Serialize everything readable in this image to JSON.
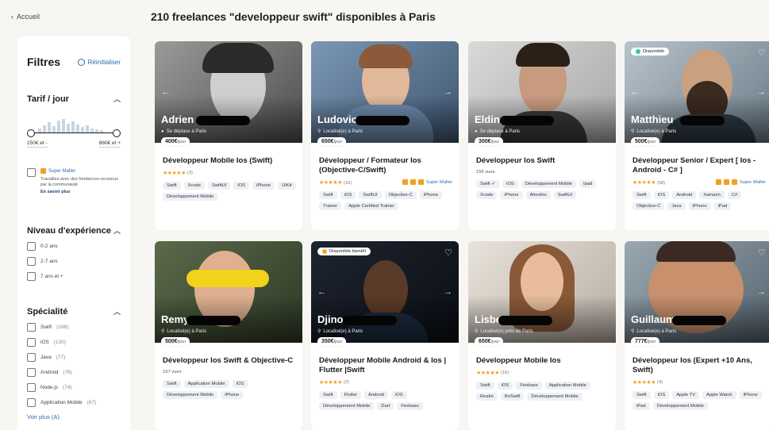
{
  "nav": {
    "back_label": "Accueil"
  },
  "page_title": "210 freelances \"developpeur swift\" disponibles à Paris",
  "filters": {
    "title": "Filtres",
    "reset_label": "Réinitialiser",
    "tarif": {
      "label": "Tarif / jour",
      "min_label": "250€ et -",
      "max_label": "860€ et +"
    },
    "super_malter": {
      "label": "Super Malter",
      "description": "Travaillez avec des freelances reconnus par la communauté",
      "learn_more": "En savoir plus"
    },
    "experience": {
      "label": "Niveau d'expérience",
      "options": [
        "0-2 ans",
        "2-7 ans",
        "7 ans et +"
      ]
    },
    "specialite": {
      "label": "Spécialité",
      "options": [
        {
          "name": "Swift",
          "count": "(196)"
        },
        {
          "name": "iOS",
          "count": "(130)"
        },
        {
          "name": "Java",
          "count": "(77)"
        },
        {
          "name": "Android",
          "count": "(76)"
        },
        {
          "name": "Node.js",
          "count": "(74)"
        },
        {
          "name": "Application Mobile",
          "count": "(67)"
        }
      ],
      "more_label": "Voir plus (A)"
    }
  },
  "cards": [
    {
      "name": "Adrien",
      "location": "Se déplace à Paris",
      "price": "400€",
      "unit": "/jour",
      "title": "Développeur Mobile Ios (Swift)",
      "stars": "★★★★★",
      "reviews": "(3)",
      "tags": [
        "Swift",
        "Xcode",
        "SwiftUI",
        "iOS",
        "iPhone",
        "UIKit",
        "Développement Mobile"
      ]
    },
    {
      "name": "Ludovic",
      "location": "Localisé(e) à Paris",
      "price": "650€",
      "unit": "/jour",
      "title": "Développeur / Formateur Ios (Objective-C/Swift)",
      "stars": "★★★★★",
      "reviews": "(16)",
      "super": "Super Malter",
      "tags": [
        "Swift",
        "iOS",
        "SwiftUI",
        "Objective-C",
        "iPhone",
        "Trainer",
        "Apple Certified Trainer"
      ]
    },
    {
      "name": "Eldin",
      "location": "Se déplace à Paris",
      "price": "300€",
      "unit": "/jour",
      "title": "Développeur Ios Swift",
      "views": "156 vues",
      "tags": [
        "Swift ✓",
        "iOS",
        "Développement Mobile",
        "Ipad",
        "Xcode",
        "iPhone",
        "Almofire",
        "SwiftUI"
      ]
    },
    {
      "name": "Matthieu",
      "location": "Localisé(e) à Paris",
      "price": "500€",
      "unit": "/jour",
      "availability": "Disponible",
      "title": "Développeur Senior / Expert [ Ios - Android - C# ]",
      "stars": "★★★★★",
      "reviews": "(58)",
      "super": "Super Malter",
      "tags": [
        "Swift",
        "iOS",
        "Android",
        "Xamarin",
        "C#",
        "Objective-C",
        "Java",
        "iPhone",
        "iPad"
      ]
    },
    {
      "name": "Remy",
      "location": "Localisé(e) à Paris",
      "price": "500€",
      "unit": "/jour",
      "title": "Développeur Ios Swift & Objective-C",
      "views": "167 vues",
      "tags": [
        "Swift",
        "Application Mobile",
        "iOS",
        "Développement Mobile",
        "iPhone"
      ]
    },
    {
      "name": "Djino",
      "location": "Localisé(e) à Paris",
      "price": "350€",
      "unit": "/jour",
      "availability": "Disponible bientôt",
      "title": "Développeur Mobile Android & Ios | Flutter |Swift",
      "stars": "★★★★★",
      "reviews": "(2)",
      "tags": [
        "Swift",
        "Flutter",
        "Android",
        "iOS",
        "Développement Mobile",
        "Dart",
        "Firebase"
      ]
    },
    {
      "name": "Lisbe",
      "location": "Localisé(e) près de Paris",
      "price": "650€",
      "unit": "/jour",
      "title": "Développeur Mobile Ios",
      "stars": "★★★★★",
      "reviews": "(16)",
      "tags": [
        "Swift",
        "iOS",
        "Firebase",
        "Application Mobile",
        "Realm",
        "RxSwift",
        "Développement Mobile"
      ]
    },
    {
      "name": "Guillaume",
      "location": "Localisé(e) à Paris",
      "price": "777€",
      "unit": "/jour",
      "title": "Développeur Ios  (Expert +10 Ans, Swift)",
      "stars": "★★★★★",
      "reviews": "(4)",
      "tags": [
        "Swift",
        "iOS",
        "Apple TV",
        "Apple Watch",
        "iPhone",
        "iPad",
        "Développement Mobile"
      ]
    }
  ],
  "colors": {
    "accent": "#2b6cb0",
    "available": "#2ecc9a",
    "soon": "#f5a623",
    "star": "#f0a020"
  }
}
